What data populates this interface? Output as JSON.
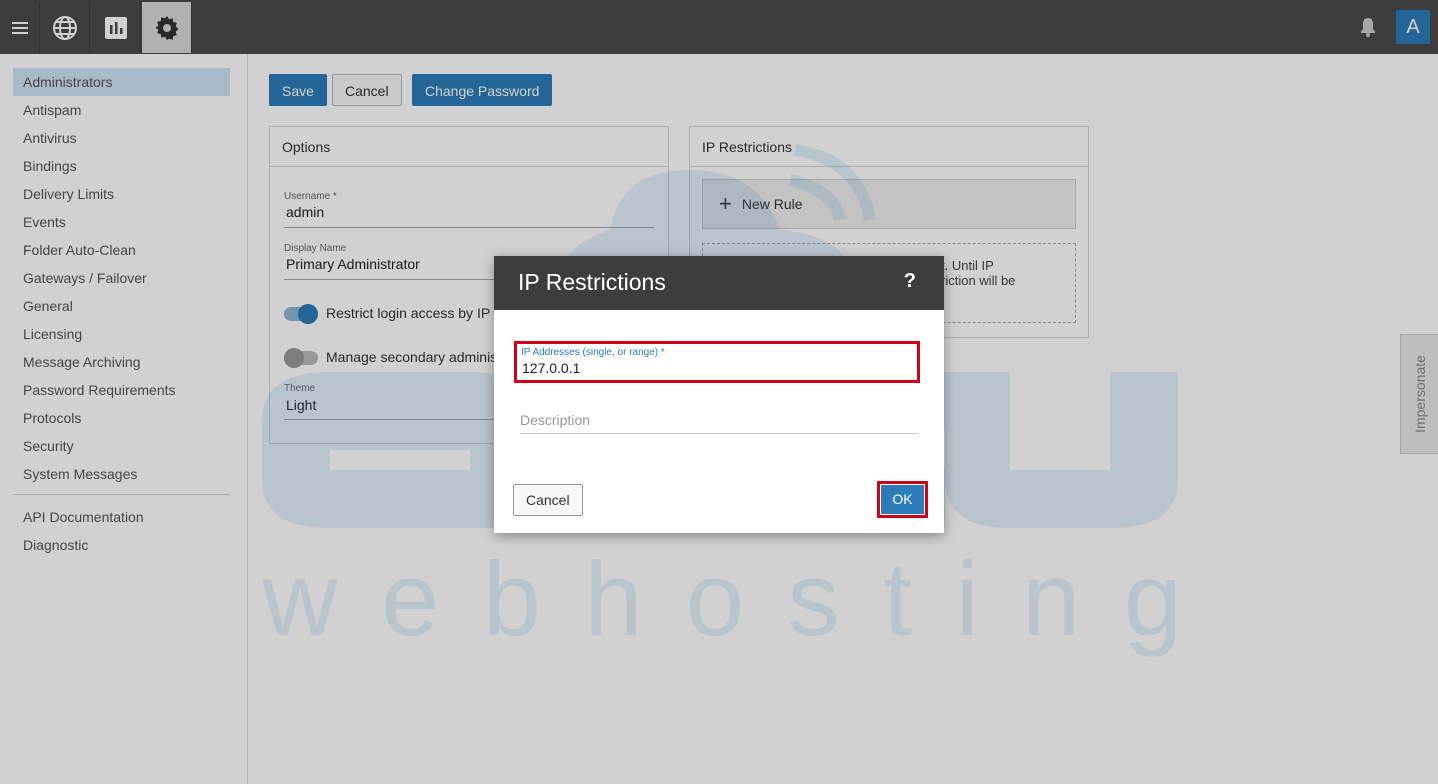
{
  "topbar": {
    "menu_icon": "hamburger-icon",
    "globe_icon": "globe-icon",
    "chart_icon": "bar-chart-icon",
    "gear_icon": "gear-icon",
    "bell_icon": "bell-icon",
    "avatar_letter": "A"
  },
  "sidebar": {
    "items": [
      {
        "label": "Administrators"
      },
      {
        "label": "Antispam"
      },
      {
        "label": "Antivirus"
      },
      {
        "label": "Bindings"
      },
      {
        "label": "Delivery Limits"
      },
      {
        "label": "Events"
      },
      {
        "label": "Folder Auto-Clean"
      },
      {
        "label": "Gateways / Failover"
      },
      {
        "label": "General"
      },
      {
        "label": "Licensing"
      },
      {
        "label": "Message Archiving"
      },
      {
        "label": "Password Requirements"
      },
      {
        "label": "Protocols"
      },
      {
        "label": "Security"
      },
      {
        "label": "System Messages"
      }
    ],
    "secondary_items": [
      {
        "label": "API Documentation"
      },
      {
        "label": "Diagnostic"
      }
    ]
  },
  "toolbar": {
    "save_label": "Save",
    "cancel_label": "Cancel",
    "change_password_label": "Change Password"
  },
  "options": {
    "title": "Options",
    "username_label": "Username *",
    "username_value": "admin",
    "display_name_label": "Display Name",
    "display_name_value": "Primary Administrator",
    "restrict_login_label": "Restrict login access by IP",
    "restrict_login_on": true,
    "manage_secondary_label": "Manage secondary adminis",
    "manage_secondary_on": false,
    "theme_label": "Theme",
    "theme_value": "Light"
  },
  "ip_restrictions": {
    "title": "IP Restrictions",
    "new_rule_label": "New Rule",
    "note_line1": "t. Until IP",
    "note_line2": "riction will be"
  },
  "impersonate_label": "Impersonate",
  "dialog": {
    "title": "IP Restrictions",
    "help_label": "?",
    "ip_label": "IP Addresses (single, or range) *",
    "ip_value": "127.0.0.1",
    "description_placeholder": "Description",
    "cancel_label": "Cancel",
    "ok_label": "OK"
  },
  "watermark": {
    "brand": "accu",
    "tagline": "w e b   h o s t i n g"
  },
  "colors": {
    "accent": "#2b7cb8",
    "highlight": "#d0021b",
    "topbar": "#4a4a4a"
  }
}
